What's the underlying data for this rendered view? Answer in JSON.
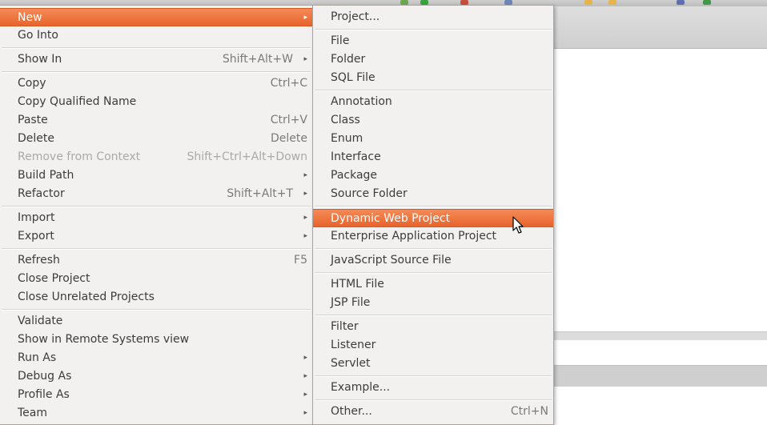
{
  "main_menu": {
    "items": [
      {
        "label": "New",
        "arrow": "▸",
        "highlighted": true
      },
      {
        "label": "Go Into"
      },
      {
        "label": "Show In",
        "accel": "Shift+Alt+W",
        "arrow": "▸"
      },
      {
        "label": "Copy",
        "accel": "Ctrl+C"
      },
      {
        "label": "Copy Qualified Name"
      },
      {
        "label": "Paste",
        "accel": "Ctrl+V"
      },
      {
        "label": "Delete",
        "accel": "Delete"
      },
      {
        "label": "Remove from Context",
        "accel": "Shift+Ctrl+Alt+Down",
        "disabled": true
      },
      {
        "label": "Build Path",
        "arrow": "▸"
      },
      {
        "label": "Refactor",
        "accel": "Shift+Alt+T",
        "arrow": "▸"
      },
      {
        "label": "Import",
        "arrow": "▸"
      },
      {
        "label": "Export",
        "arrow": "▸"
      },
      {
        "label": "Refresh",
        "accel": "F5"
      },
      {
        "label": "Close Project"
      },
      {
        "label": "Close Unrelated Projects"
      },
      {
        "label": "Validate"
      },
      {
        "label": "Show in Remote Systems view"
      },
      {
        "label": "Run As",
        "arrow": "▸"
      },
      {
        "label": "Debug As",
        "arrow": "▸"
      },
      {
        "label": "Profile As",
        "arrow": "▸"
      },
      {
        "label": "Team",
        "arrow": "▸"
      }
    ]
  },
  "sub_menu": {
    "items": [
      {
        "label": "Project..."
      },
      {
        "label": "File"
      },
      {
        "label": "Folder"
      },
      {
        "label": "SQL File"
      },
      {
        "label": "Annotation"
      },
      {
        "label": "Class"
      },
      {
        "label": "Enum"
      },
      {
        "label": "Interface"
      },
      {
        "label": "Package"
      },
      {
        "label": "Source Folder"
      },
      {
        "label": "Dynamic Web Project",
        "highlighted": true
      },
      {
        "label": "Enterprise Application Project"
      },
      {
        "label": "JavaScript Source File"
      },
      {
        "label": "HTML File"
      },
      {
        "label": "JSP File"
      },
      {
        "label": "Filter"
      },
      {
        "label": "Listener"
      },
      {
        "label": "Servlet"
      },
      {
        "label": "Example..."
      },
      {
        "label": "Other...",
        "accel": "Ctrl+N"
      }
    ]
  },
  "colors": {
    "highlight": "#e8642c",
    "menu_bg": "#f2f1f0"
  },
  "icons": {
    "cursor": "mouse-pointer-icon",
    "submenu": "chevron-right-icon"
  }
}
